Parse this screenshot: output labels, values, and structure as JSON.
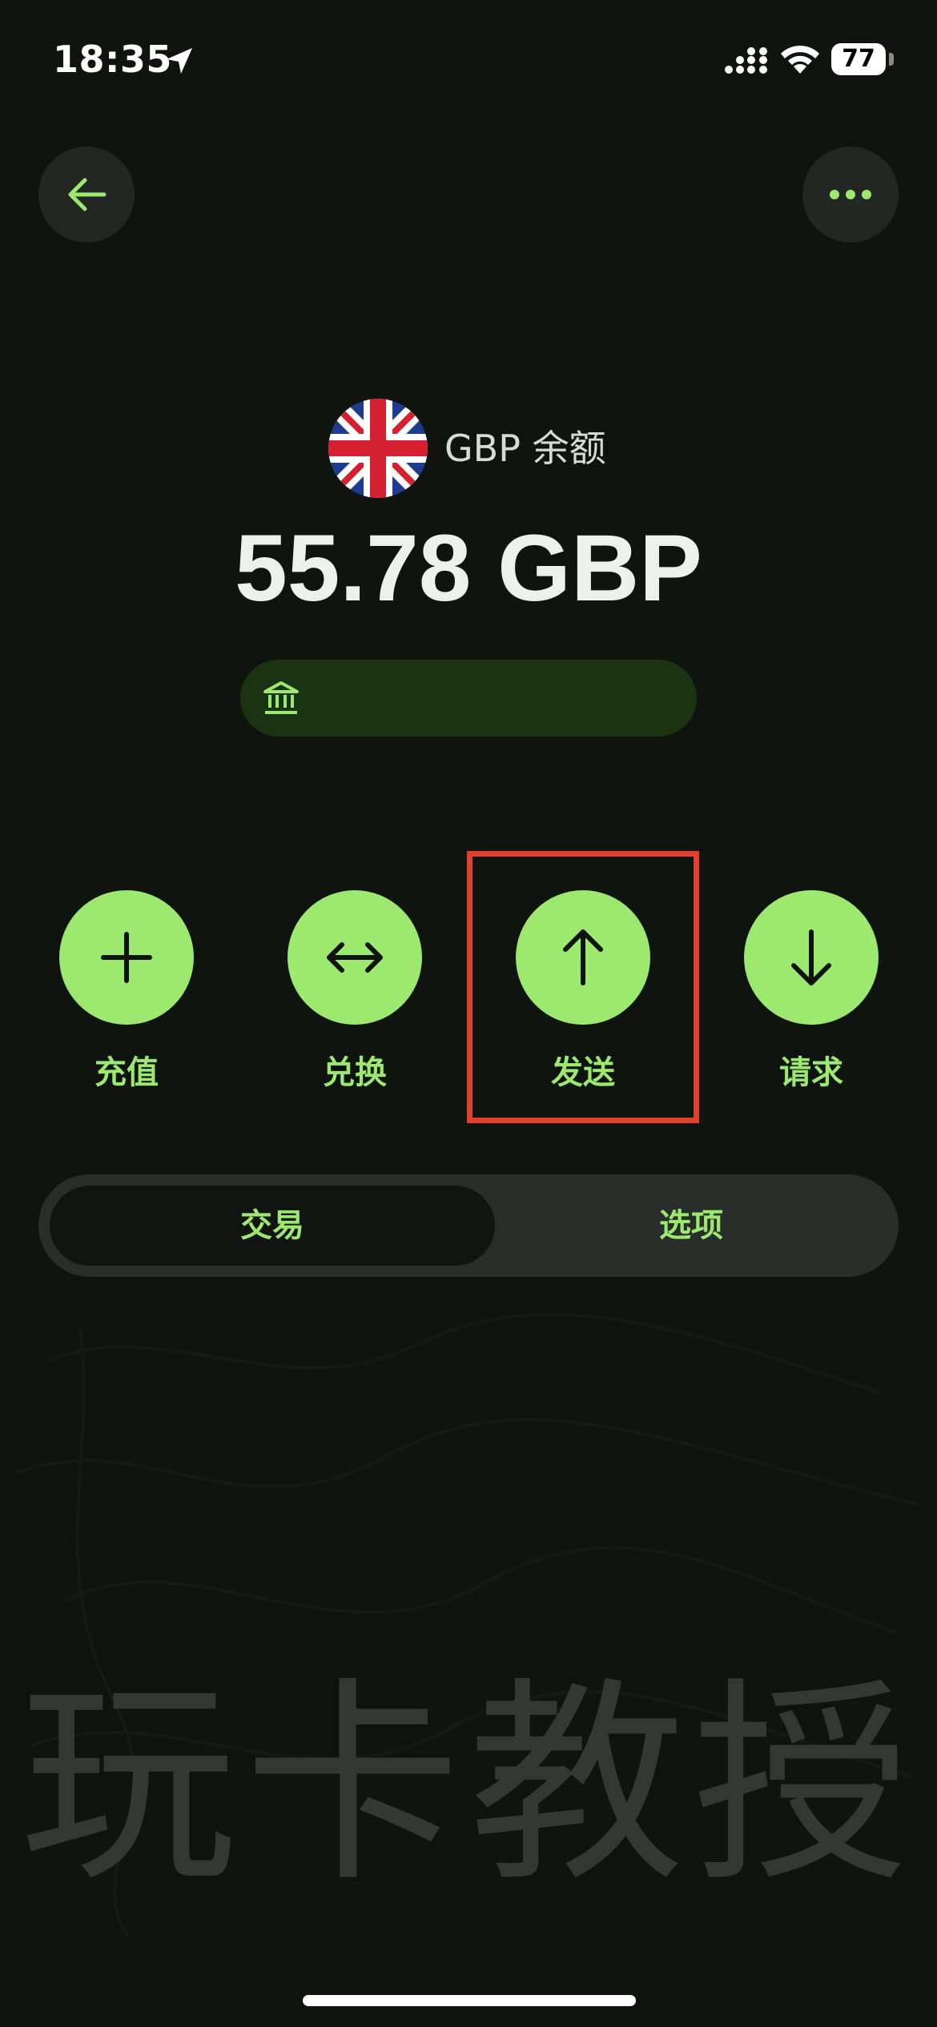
{
  "status_bar": {
    "time": "18:35",
    "battery": "77"
  },
  "balance": {
    "label": "GBP 余额",
    "amount": "55.78 GBP",
    "currency_icon": "uk-flag-icon",
    "bank_icon": "bank-icon"
  },
  "actions": [
    {
      "label": "充值",
      "icon": "plus-icon"
    },
    {
      "label": "兑换",
      "icon": "double-arrow-icon"
    },
    {
      "label": "发送",
      "icon": "arrow-up-icon"
    },
    {
      "label": "请求",
      "icon": "arrow-down-icon"
    }
  ],
  "tabs": [
    {
      "label": "交易",
      "active": true
    },
    {
      "label": "选项",
      "active": false
    }
  ],
  "watermark": "玩卡教授",
  "colors": {
    "background": "#0f150e",
    "accent": "#9de86f",
    "highlight": "#e53e2e",
    "surface": "#2a2e2b"
  }
}
